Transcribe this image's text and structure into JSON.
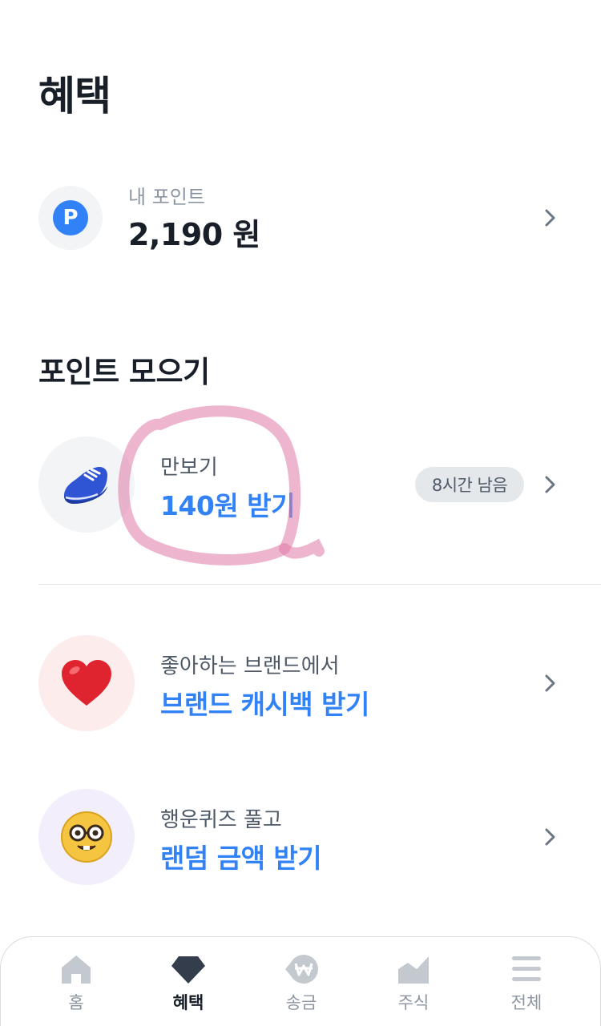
{
  "header": {
    "title": "혜택"
  },
  "points": {
    "label": "내 포인트",
    "value": "2,190 원",
    "icon_letter": "P",
    "icon": "point-icon"
  },
  "section": {
    "title": "포인트 모으기"
  },
  "rows": [
    {
      "icon": "sneaker-icon",
      "sub": "만보기",
      "main": "140원 받기",
      "badge": "8시간 남음"
    },
    {
      "icon": "heart-icon",
      "sub": "좋아하는 브랜드에서",
      "main": "브랜드 캐시백 받기"
    },
    {
      "icon": "nerd-face-icon",
      "sub": "행운퀴즈 풀고",
      "main": "랜덤 금액 받기"
    }
  ],
  "tabbar": {
    "tabs": [
      {
        "label": "홈",
        "icon": "home-icon",
        "active": false
      },
      {
        "label": "혜택",
        "icon": "gem-icon",
        "active": true
      },
      {
        "label": "송금",
        "icon": "won-transfer-icon",
        "active": false
      },
      {
        "label": "주식",
        "icon": "stock-chart-icon",
        "active": false
      },
      {
        "label": "전체",
        "icon": "menu-icon",
        "active": false
      }
    ]
  },
  "colors": {
    "accent": "#3182f6",
    "text_primary": "#191f28",
    "text_secondary": "#4e5968",
    "text_tertiary": "#8b95a1",
    "annotation": "#e07aa6"
  }
}
